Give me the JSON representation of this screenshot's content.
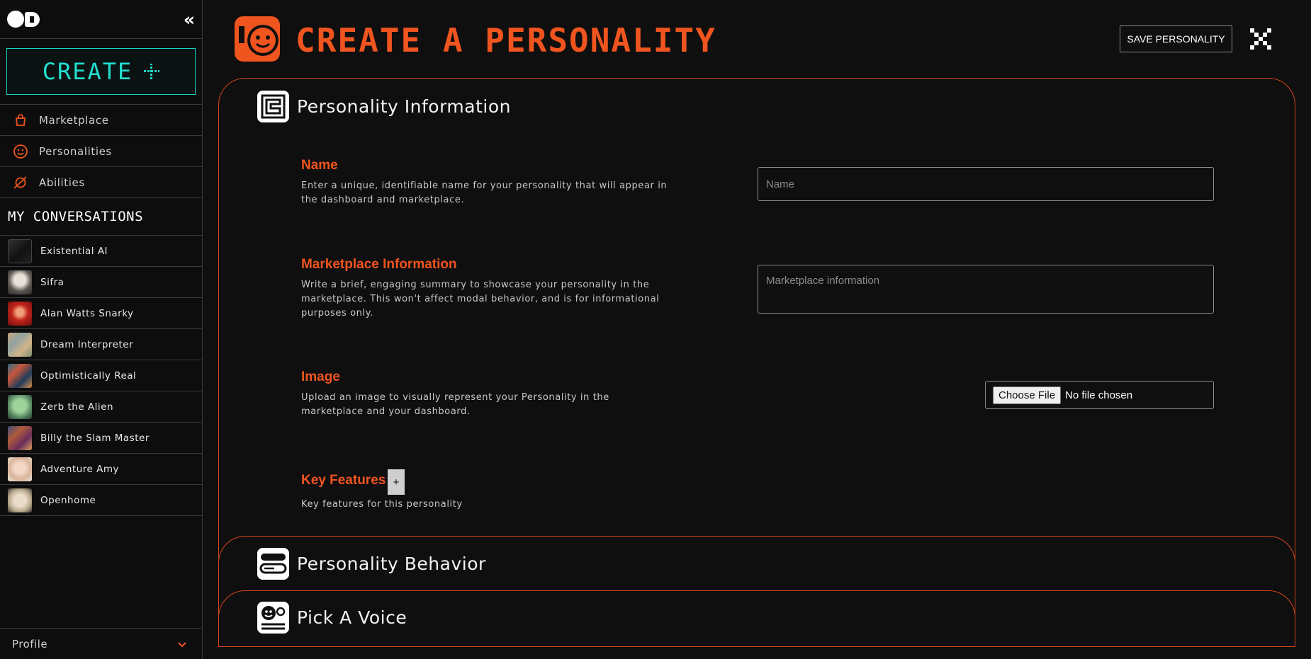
{
  "sidebar": {
    "create_label": "CREATE",
    "nav": [
      {
        "label": "Marketplace",
        "icon": "shopping-bag-icon"
      },
      {
        "label": "Personalities",
        "icon": "smiley-icon"
      },
      {
        "label": "Abilities",
        "icon": "orbit-icon"
      }
    ],
    "conversations_title": "MY CONVERSATIONS",
    "conversations": [
      {
        "label": "Existential AI"
      },
      {
        "label": "Sifra"
      },
      {
        "label": "Alan Watts Snarky"
      },
      {
        "label": "Dream Interpreter"
      },
      {
        "label": "Optimistically Real"
      },
      {
        "label": "Zerb the Alien"
      },
      {
        "label": "Billy the Slam Master"
      },
      {
        "label": "Adventure Amy"
      },
      {
        "label": "Openhome"
      }
    ],
    "profile_label": "Profile"
  },
  "header": {
    "title": "CREATE A PERSONALITY",
    "save_label": "SAVE PERSONALITY"
  },
  "sections": {
    "info": {
      "title": "Personality Information",
      "name": {
        "label": "Name",
        "description": "Enter a unique, identifiable name for your personality that will appear in the dashboard and marketplace.",
        "placeholder": "Name"
      },
      "marketplace": {
        "label": "Marketplace Information",
        "description": "Write a brief, engaging summary to showcase your personality in the marketplace. This won't affect modal behavior, and is for informational purposes only.",
        "placeholder": "Marketplace information"
      },
      "image": {
        "label": "Image",
        "description": "Upload an image to visually represent your Personality in the marketplace and your dashboard.",
        "button": "Choose File",
        "status": "No file chosen"
      },
      "features": {
        "label": "Key Features",
        "add": "+",
        "description": "Key features for this personality"
      }
    },
    "behavior": {
      "title": "Personality Behavior"
    },
    "voice": {
      "title": "Pick A Voice"
    }
  },
  "colors": {
    "accent": "#f0541f",
    "teal": "#22e0cf",
    "background": "#0f0f0f"
  }
}
